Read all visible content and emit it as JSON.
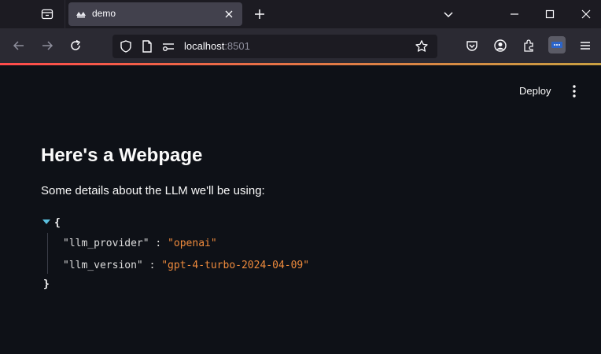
{
  "browser": {
    "tab_title": "demo",
    "url_host": "localhost",
    "url_port": ":8501",
    "icons": [
      "tab-list-icon",
      "streamlit-favicon",
      "close-icon",
      "plus-icon",
      "chevron-down-icon",
      "minimize-icon",
      "maximize-icon",
      "window-close-icon",
      "back-icon",
      "forward-icon",
      "reload-icon",
      "shield-icon",
      "page-icon",
      "permissions-icon",
      "star-icon",
      "pocket-icon",
      "account-icon",
      "extensions-icon",
      "extension-more-icon",
      "hamburger-icon"
    ]
  },
  "app": {
    "deploy_label": "Deploy",
    "title": "Here's a Webpage",
    "description": "Some details about the LLM we'll be using:",
    "json_open": "{",
    "json_close": "}",
    "json": [
      {
        "key": "\"llm_provider\"",
        "value": "\"openai\""
      },
      {
        "key": "\"llm_version\"",
        "value": "\"gpt-4-turbo-2024-04-09\""
      }
    ]
  },
  "colors": {
    "background": "#0e1117",
    "json_string": "#ee8a3c",
    "toggle_accent": "#5bc0de"
  }
}
